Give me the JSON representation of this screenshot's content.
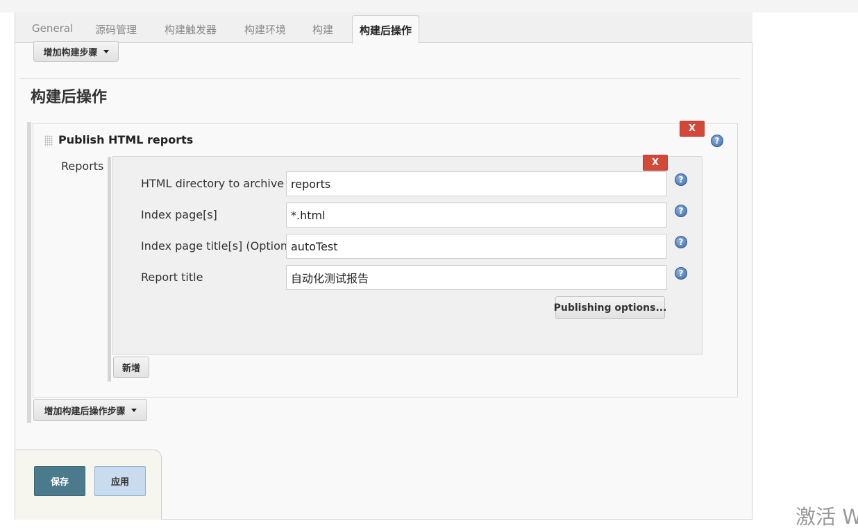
{
  "tabs": [
    {
      "label": "General"
    },
    {
      "label": "源码管理"
    },
    {
      "label": "构建触发器"
    },
    {
      "label": "构建环境"
    },
    {
      "label": "构建"
    },
    {
      "label": "构建后操作"
    }
  ],
  "build": {
    "add_step_label": "增加构建步骤"
  },
  "post_build": {
    "section_title": "构建后操作",
    "publisher": {
      "title": "Publish HTML reports",
      "delete_label": "X",
      "reports_label": "Reports",
      "report": {
        "delete_label": "X",
        "fields": [
          {
            "label": "HTML directory to archive",
            "value": "reports"
          },
          {
            "label": "Index page[s]",
            "value": "*.html"
          },
          {
            "label": "Index page title[s] (Optional)",
            "value": "autoTest"
          },
          {
            "label": "Report title",
            "value": "自动化测试报告"
          }
        ],
        "publishing_options_label": "Publishing options..."
      },
      "add_label": "新增"
    },
    "add_step_label": "增加构建后操作步骤"
  },
  "footer": {
    "save_label": "保存",
    "apply_label": "应用"
  },
  "watermark": "激活 W",
  "help_glyph": "?",
  "colors": {
    "delete": "#d24939",
    "save": "#4a7a8c",
    "apply": "#c9dbee",
    "help": "#3c6aa8"
  }
}
